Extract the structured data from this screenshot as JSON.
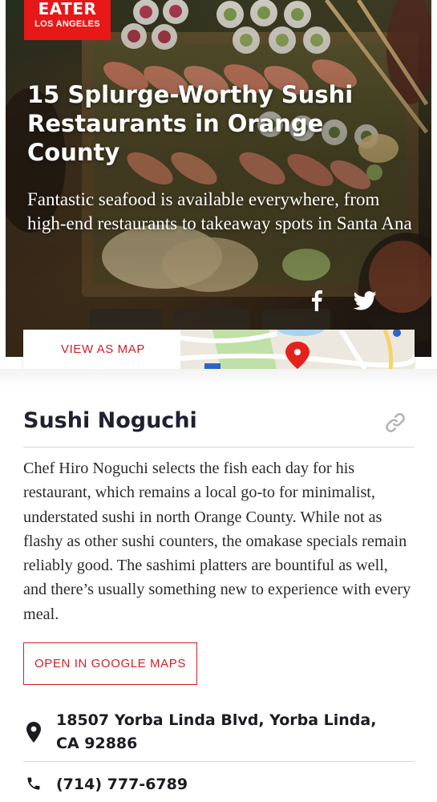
{
  "brand": {
    "name": "EATER",
    "city": "LOS ANGELES",
    "color": "#e81818"
  },
  "hero": {
    "title": "15 Splurge-Worthy Sushi Restaurants in Orange County",
    "subtitle": "Fantastic seafood is available everywhere, from high-end restaurants to takeaway spots in Santa Ana",
    "share_icons": [
      "facebook-icon",
      "twitter-icon"
    ]
  },
  "map_card": {
    "link_label": "VIEW AS MAP",
    "accent": "#d41f26"
  },
  "entry": {
    "name": "Sushi Noguchi",
    "description": "Chef Hiro Noguchi selects the fish each day for his restaurant, which remains a local go-to for minimalist, understated sushi in north Orange County. While not as flashy as other sushi counters, the omakase specials remain reliably good. The sashimi platters are bountiful as well, and there’s usually something new to experience with every meal.",
    "maps_button_label": "OPEN IN GOOGLE MAPS",
    "address": "18507 Yorba Linda Blvd, Yorba Linda, CA 92886",
    "phone": "(714) 777-6789",
    "icons": {
      "link": "link-icon",
      "address": "map-pin-icon",
      "phone": "phone-icon"
    }
  }
}
